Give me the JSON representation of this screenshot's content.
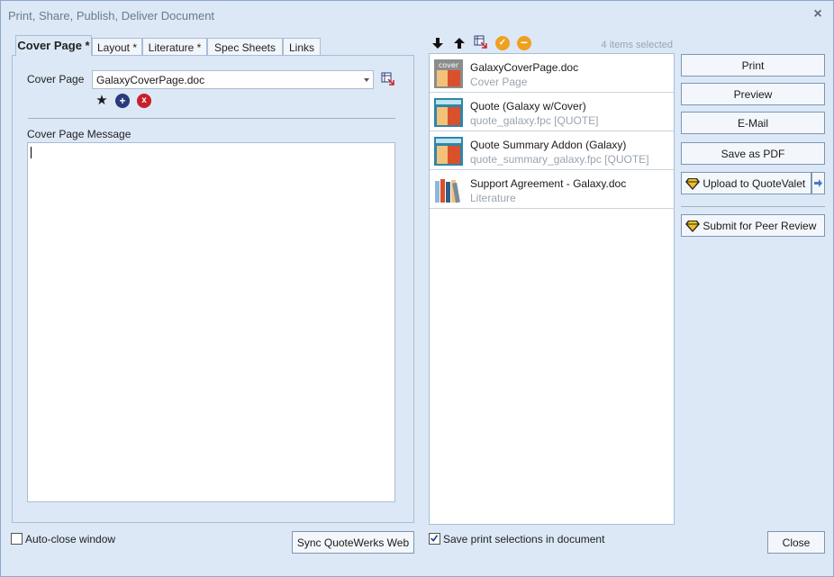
{
  "window": {
    "title": "Print, Share, Publish, Deliver Document",
    "close_glyph": "×"
  },
  "tabs": [
    {
      "label": "Cover Page *",
      "active": true
    },
    {
      "label": "Layout *",
      "active": false
    },
    {
      "label": "Literature *",
      "active": false
    },
    {
      "label": "Spec Sheets",
      "active": false
    },
    {
      "label": "Links",
      "active": false
    }
  ],
  "cover_page": {
    "field_label": "Cover Page",
    "selected_value": "GalaxyCoverPage.doc",
    "message_label": "Cover Page Message",
    "message_value": ""
  },
  "list_toolbar": {
    "move_down_icon": "arrow-down-icon",
    "move_up_icon": "arrow-up-icon",
    "selection_status": "4 items selected"
  },
  "documents": [
    {
      "name": "GalaxyCoverPage.doc",
      "sub": "Cover Page",
      "thumb": "cover",
      "thumb_text": "cover"
    },
    {
      "name": "Quote (Galaxy w/Cover)",
      "sub": "quote_galaxy.fpc [QUOTE]",
      "thumb": "quote",
      "thumb_text": ""
    },
    {
      "name": "Quote Summary Addon (Galaxy)",
      "sub": "quote_summary_galaxy.fpc [QUOTE]",
      "thumb": "quote",
      "thumb_text": ""
    },
    {
      "name": "Support Agreement - Galaxy.doc",
      "sub": "Literature",
      "thumb": "books",
      "thumb_text": ""
    }
  ],
  "actions": {
    "print": "Print",
    "preview": "Preview",
    "email": "E-Mail",
    "save_pdf": "Save as PDF",
    "upload": "Upload to QuoteValet",
    "peer_review": "Submit for Peer Review",
    "close": "Close"
  },
  "bottom": {
    "auto_close_label": "Auto-close window",
    "auto_close_checked": false,
    "sync_button": "Sync QuoteWerks Web",
    "save_selections_label": "Save print selections in document",
    "save_selections_checked": true
  },
  "colors": {
    "window_bg": "#dce8f6",
    "accent_orange": "#f0a020",
    "accent_navy": "#2a3a7c",
    "accent_red": "#c8202a"
  }
}
